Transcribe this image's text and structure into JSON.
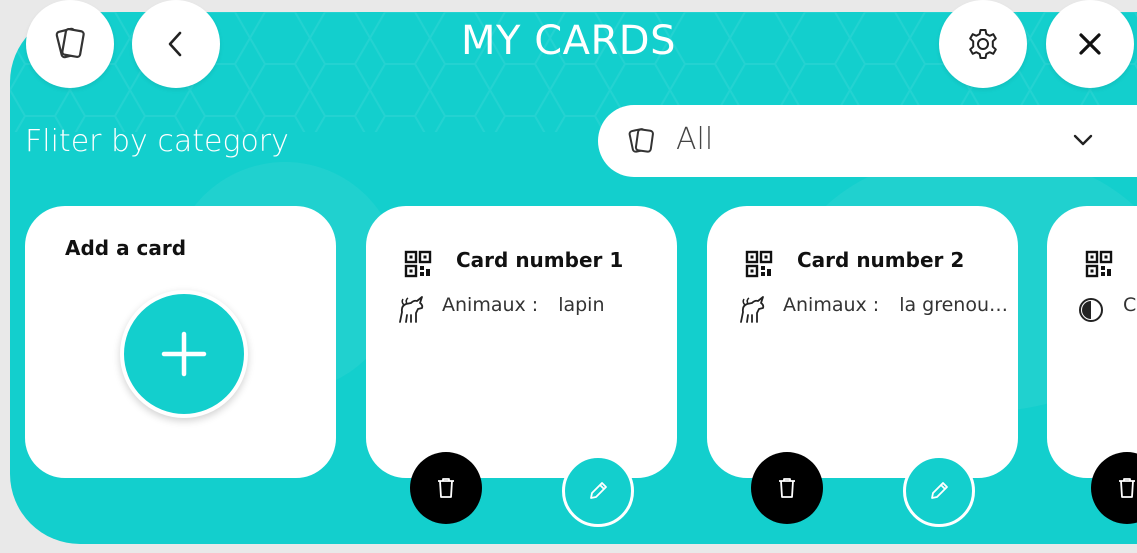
{
  "header": {
    "title": "MY CARDS",
    "cards_icon": "cards-stack-icon",
    "back_icon": "chevron-left-icon",
    "settings_icon": "gear-icon",
    "close_icon": "close-icon"
  },
  "filter": {
    "label": "Fliter by category",
    "selected": "All",
    "icon": "cards-icon",
    "chevron": "chevron-down-icon"
  },
  "add_card": {
    "label": "Add a card",
    "icon": "plus-icon"
  },
  "cards": [
    {
      "title": "Card number 1",
      "category": "Animaux :",
      "value": "lapin",
      "category_icon": "unicorn-icon"
    },
    {
      "title": "Card number 2",
      "category": "Animaux :",
      "value": "la grenou…",
      "category_icon": "unicorn-icon"
    },
    {
      "title": "",
      "category": "C",
      "value": "",
      "category_icon": "contrast-icon"
    }
  ],
  "colors": {
    "primary": "#13cfcd",
    "surface": "#ffffff",
    "danger_action": "#000000"
  }
}
